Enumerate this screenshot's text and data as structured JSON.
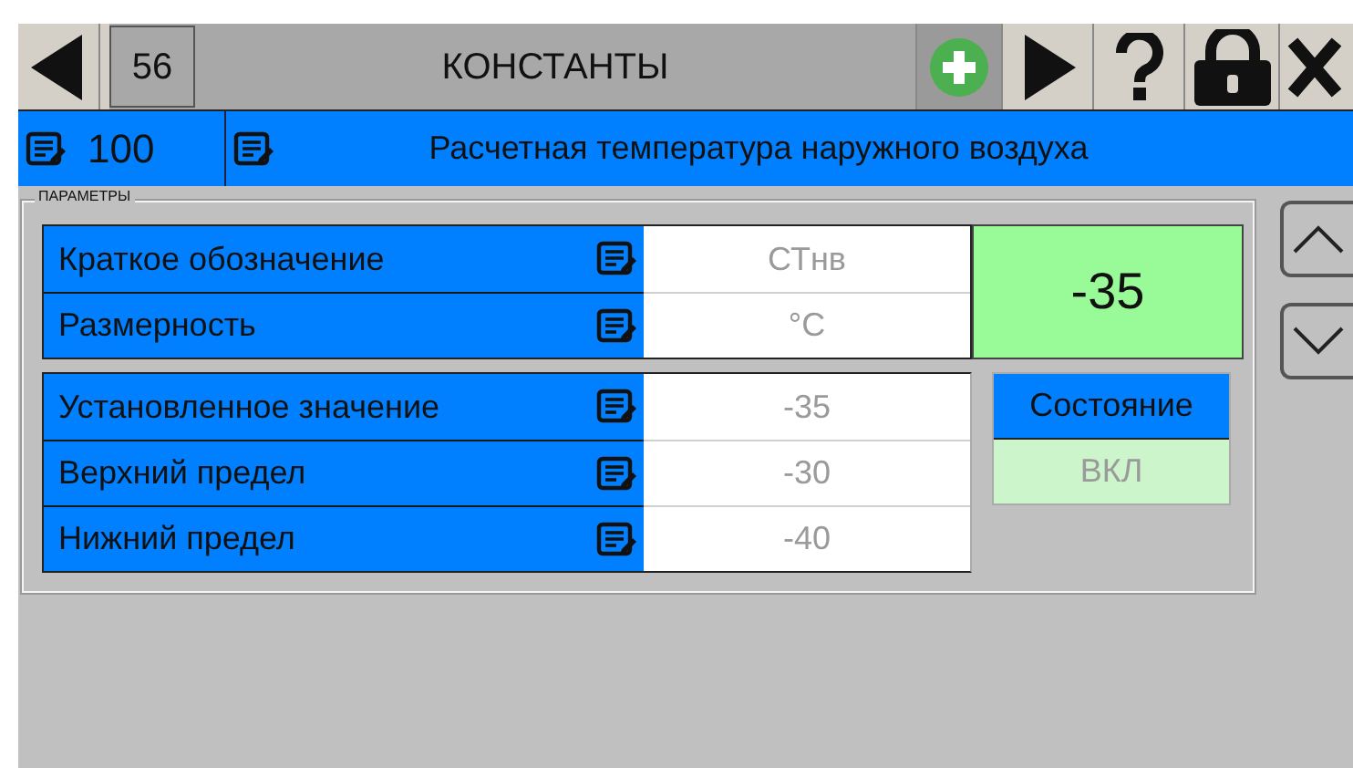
{
  "toolbar": {
    "screen_number": "56",
    "title": "КОНСТАНТЫ"
  },
  "header": {
    "number": "100",
    "name": "Расчетная температура наружного воздуха"
  },
  "group": {
    "legend": "ПАРАМЕТРЫ",
    "descriptor_rows": [
      {
        "label": "Краткое обозначение",
        "value": "СТнв"
      },
      {
        "label": "Размерность",
        "value": "°C"
      }
    ],
    "current_value": "-35",
    "value_rows": [
      {
        "label": "Установленное значение",
        "value": "-35"
      },
      {
        "label": "Верхний предел",
        "value": "-30"
      },
      {
        "label": "Нижний предел",
        "value": "-40"
      }
    ],
    "status": {
      "label": "Состояние",
      "value": "ВКЛ"
    }
  }
}
